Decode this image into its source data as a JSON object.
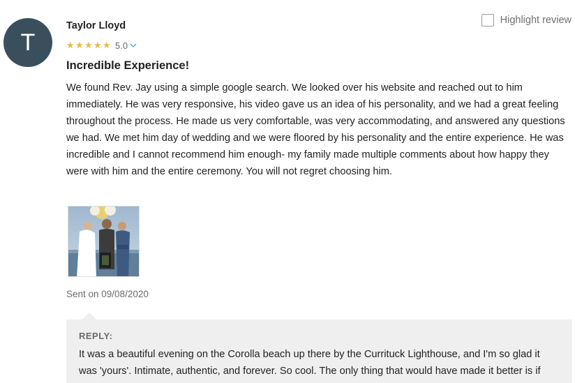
{
  "reviewer": {
    "initial": "T",
    "name": "Taylor Lloyd",
    "rating": "5.0",
    "star_count": 5,
    "star_color": "#e8b84b",
    "avatar_color": "#3a4f5c"
  },
  "highlight": {
    "label": "Highlight review",
    "checked": false
  },
  "review": {
    "title": "Incredible Experience!",
    "body": "We found Rev. Jay using a simple google search. We looked over his website and reached out to him immediately. He was very responsive, his video gave us an idea of his personality, and we had a great feeling throughout the process. He made us very comfortable, was very accommodating, and answered any questions we had. We met him day of wedding and we were floored by his personality and the entire experience. He was incredible and I cannot recommend him enough- my family made multiple comments about how happy they were with him and the entire ceremony. You will not regret choosing him.",
    "sent_date": "Sent on 09/08/2020"
  },
  "reply": {
    "label": "REPLY:",
    "text": "It was a beautiful evening on the Corolla beach up there by the Currituck Lighthouse, and I'm so glad it was 'yours'. Intimate, authentic, and forever. So cool. The only thing that would have made it better is if your bird was able to be up there with us :)"
  }
}
